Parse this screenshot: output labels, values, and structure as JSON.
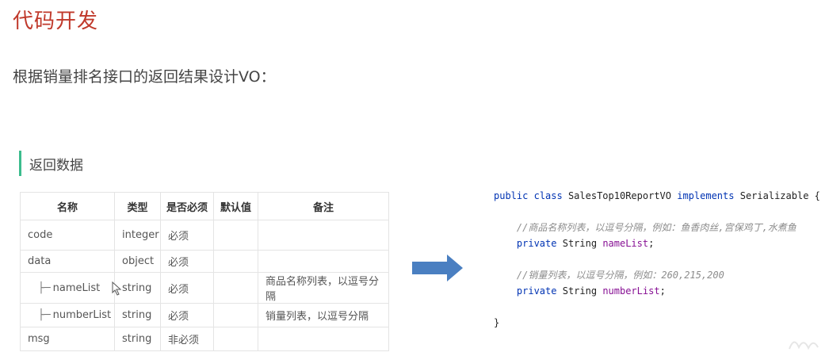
{
  "heading": "代码开发",
  "subheading": "根据销量排名接口的返回结果设计VO：",
  "section_title": "返回数据",
  "table": {
    "headers": [
      "名称",
      "类型",
      "是否必须",
      "默认值",
      "备注"
    ],
    "rows": [
      {
        "name": "code",
        "type": "integer",
        "required": "必须",
        "default": "",
        "note": "",
        "tree": ""
      },
      {
        "name": "data",
        "type": "object",
        "required": "必须",
        "default": "",
        "note": "",
        "tree": ""
      },
      {
        "name": "nameList",
        "type": "string",
        "required": "必须",
        "default": "",
        "note": "商品名称列表，以逗号分隔",
        "tree": "├─"
      },
      {
        "name": "numberList",
        "type": "string",
        "required": "必须",
        "default": "",
        "note": "销量列表，以逗号分隔",
        "tree": "├─"
      },
      {
        "name": "msg",
        "type": "string",
        "required": "非必须",
        "default": "",
        "note": "",
        "tree": ""
      }
    ]
  },
  "code": {
    "class_kw1": "public",
    "class_kw2": "class",
    "class_name": "SalesTop10ReportVO",
    "implements_kw": "implements",
    "interface_name": "Serializable",
    "open_brace": "{",
    "comment1": "//商品名称列表，以逗号分隔，例如：鱼香肉丝,宫保鸡丁,水煮鱼",
    "field1_kw": "private",
    "field1_type": "String",
    "field1_name": "nameList",
    "comment2": "//销量列表，以逗号分隔，例如：260,215,200",
    "field2_kw": "private",
    "field2_type": "String",
    "field2_name": "numberList",
    "semicolon": ";",
    "close_brace": "}"
  },
  "colors": {
    "heading": "#c0392b",
    "section_bar": "#3cbc8d",
    "arrow": "#4a7fc1",
    "keyword": "#0033b3",
    "field": "#871094",
    "comment": "#8c8c8c"
  },
  "icons": [
    "right-arrow-icon",
    "mouse-cursor-icon"
  ]
}
